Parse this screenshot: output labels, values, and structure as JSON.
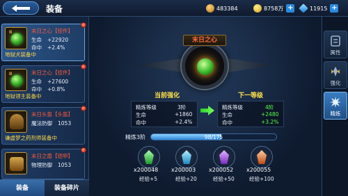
{
  "header": {
    "title": "装备",
    "resources": [
      {
        "icon": "coin-stack-icon",
        "value": "483384",
        "color": "#e8a83a"
      },
      {
        "icon": "gold-coin-icon",
        "value": "8758万",
        "color": "#f2c53a"
      },
      {
        "icon": "diamond-icon",
        "value": "11915",
        "color": "#4ac2ff"
      }
    ]
  },
  "equipment_list": [
    {
      "name": "末日之心【挂件】",
      "lines": [
        {
          "label": "生命",
          "value": "+22920"
        },
        {
          "label": "命中",
          "value": "+2.4%"
        }
      ],
      "footer": "地狱犬装备中",
      "icon": "green-orb-icon"
    },
    {
      "name": "末日之心【挂件】",
      "lines": [
        {
          "label": "生命",
          "value": "+27600"
        },
        {
          "label": "命中",
          "value": "+0.8%"
        }
      ],
      "footer": "地狱领主装备中",
      "icon": "green-orb-icon"
    },
    {
      "name": "末日头盔【头盔】",
      "lines": [
        {
          "label": "魔法防御",
          "value": "1053"
        }
      ],
      "footer": "谦虚梦之药剂师装备中",
      "icon": "helmet-icon"
    },
    {
      "name": "末日之盾【铠甲】",
      "lines": [
        {
          "label": "物理防御",
          "value": "1053"
        }
      ],
      "footer": "",
      "icon": "armor-icon"
    }
  ],
  "bottom_tabs": [
    "装备",
    "装备碎片"
  ],
  "detail": {
    "item_title": "末日之心",
    "current_header": "当前强化",
    "next_header": "下一等级",
    "current": {
      "level_label": "精炼等级",
      "level": "3阶",
      "hp_label": "生命",
      "hp": "+1860",
      "hit_label": "命中",
      "hit": "+2.4%"
    },
    "next": {
      "level_label": "精炼等级",
      "level": "4阶",
      "hp_label": "生命",
      "hp": "+2480",
      "hit_label": "命中",
      "hit": "+3.2%"
    },
    "exp_label": "精炼3阶",
    "exp_text": "98/175",
    "exp_progress": 0.56
  },
  "stones": [
    {
      "count": "x200048",
      "exp": "经验+5",
      "color": "#3ad24a",
      "icon": "green-crystal-icon"
    },
    {
      "count": "x200003",
      "exp": "经验+20",
      "color": "#2ab8e8",
      "icon": "blue-crystal-icon"
    },
    {
      "count": "x200052",
      "exp": "经验+50",
      "color": "#a24ae8",
      "icon": "purple-crystal-icon"
    },
    {
      "count": "x200055",
      "exp": "经验+100",
      "color": "#e86a2a",
      "icon": "orange-crystal-icon"
    }
  ],
  "side_tabs": [
    {
      "label": "属性",
      "icon": "attribute-icon"
    },
    {
      "label": "强化",
      "icon": "enhance-icon"
    },
    {
      "label": "精炼",
      "icon": "refine-icon"
    }
  ]
}
